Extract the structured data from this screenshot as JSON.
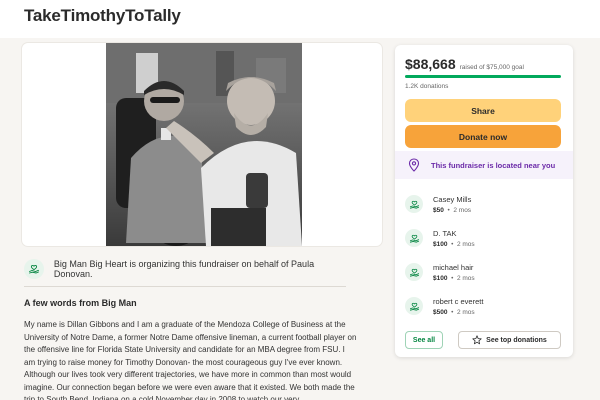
{
  "page": {
    "title": "TakeTimothyToTally"
  },
  "organizer": {
    "text": "Big Man Big Heart is organizing this fundraiser on behalf of Paula Donovan."
  },
  "story": {
    "heading": "A few words from Big Man",
    "body": "My name is Dillan Gibbons and I am a graduate of the Mendoza College of Business at the University of Notre Dame, a former Notre Dame offensive lineman, a current football player on the offensive line for Florida State University and candidate for an MBA degree from FSU. I am trying to raise money for Timothy Donovan- the most courageous guy I've ever known. Although our lives took very different trajectories, we have more in common than most would imagine. Our connection began before we were even aware that it existed. We both made the trip to South Bend, Indiana on a cold November day in 2008 to watch our very"
  },
  "donation_panel": {
    "amount_raised": "$88,668",
    "goal_text": "raised of $75,000 goal",
    "progress_percent": 100,
    "donation_count": "1.2K donations",
    "share_label": "Share",
    "donate_label": "Donate now",
    "near_text": "This fundraiser is located near you",
    "donors": [
      {
        "name": "Casey Mills",
        "amount": "$50",
        "time": "2 mos"
      },
      {
        "name": "D. TAK",
        "amount": "$100",
        "time": "2 mos"
      },
      {
        "name": "michael hair",
        "amount": "$100",
        "time": "2 mos"
      },
      {
        "name": "robert c everett",
        "amount": "$500",
        "time": "2 mos"
      }
    ],
    "see_all_label": "See all",
    "top_donations_label": "See top donations"
  },
  "colors": {
    "brand_green": "#02a95c",
    "share_yellow": "#ffd27a",
    "donate_orange": "#f7a33a",
    "near_purple": "#6b2aa8"
  },
  "icons": {
    "organizer": "heart-hand-icon",
    "location": "location-pin-icon",
    "donor": "heart-hand-icon",
    "star": "star-icon"
  }
}
